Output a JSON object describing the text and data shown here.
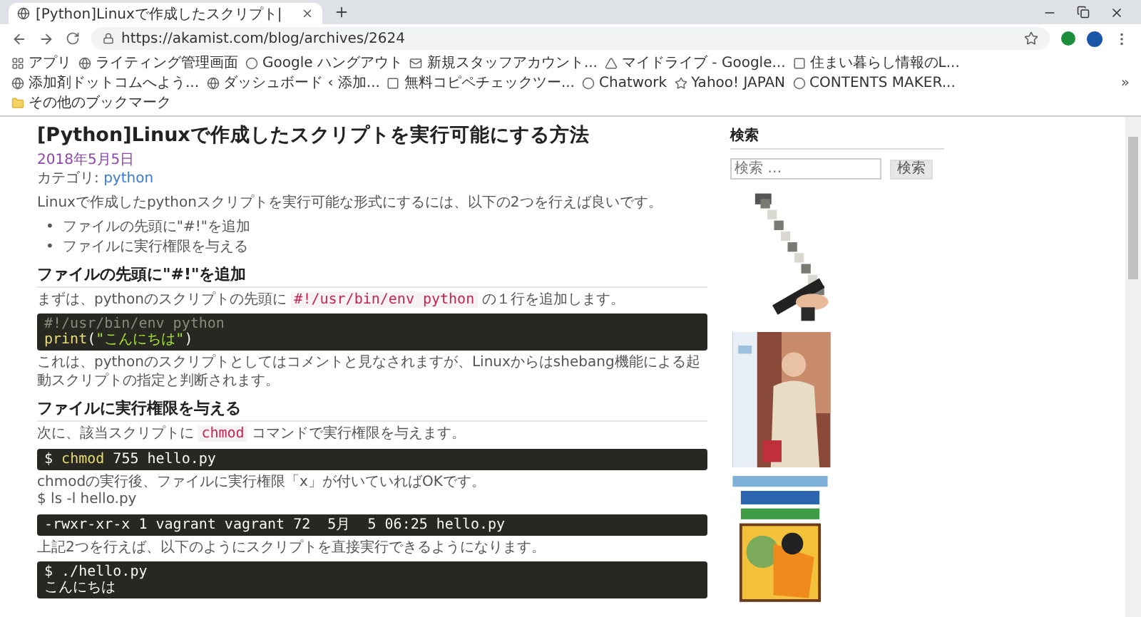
{
  "browser": {
    "tab": {
      "title": "[Python]Linuxで作成したスクリプト|"
    },
    "url": "https://akamist.com/blog/archives/2624",
    "bookmarks": [
      {
        "label": "アプリ"
      },
      {
        "label": "ライティング管理画面"
      },
      {
        "label": "Google ハングアウト"
      },
      {
        "label": "新規スタッフアカウント..."
      },
      {
        "label": "マイドライブ - Google..."
      },
      {
        "label": "住まい暮らし情報のL..."
      },
      {
        "label": "添加剤ドットコムへよう..."
      },
      {
        "label": "ダッシュボード ‹ 添加..."
      },
      {
        "label": "無料コピペチェックツー..."
      },
      {
        "label": "Chatwork"
      },
      {
        "label": "Yahoo! JAPAN"
      },
      {
        "label": "CONTENTS MAKER..."
      }
    ],
    "overflow": "»",
    "other_bookmarks": "その他のブックマーク"
  },
  "article": {
    "title": "[Python]Linuxで作成したスクリプトを実行可能にする方法",
    "date": "2018年5月5日",
    "category_label": "カテゴリ:",
    "category": "python",
    "blocks": [
      {
        "kind": "paragraph",
        "lines": [
          [
            {
              "text": "Linuxで作成したpythonスクリプトを実行可能な形式にするには、以下の2つを行えば良いです。"
            }
          ]
        ]
      },
      {
        "kind": "list",
        "marker": "•",
        "items": [
          "ファイルの先頭に\"#!\"を追加",
          "ファイルに実行権限を与える"
        ]
      },
      {
        "kind": "heading",
        "text": "ファイルの先頭に\"#!\"を追加"
      },
      {
        "kind": "paragraph",
        "lines": [
          [
            {
              "text": "まずは、pythonのスクリプトの先頭に "
            },
            {
              "code": "#!/usr/bin/env python"
            },
            {
              "text": " の１行を追加します。"
            }
          ]
        ]
      },
      {
        "kind": "code",
        "lines": [
          [
            {
              "kind": "comment",
              "text": "#!/usr/bin/env python"
            }
          ],
          [
            {
              "kind": "keyword",
              "text": "print"
            },
            {
              "kind": "plain",
              "text": "("
            },
            {
              "kind": "string",
              "text": "\"こんにちは\""
            },
            {
              "kind": "plain",
              "text": ")"
            }
          ]
        ]
      },
      {
        "kind": "paragraph",
        "lines": [
          [
            {
              "text": "これは、pythonのスクリプトとしてはコメントと見なされますが、Linuxからはshebang機能による起動スクリプトの指定と判断されます。"
            }
          ]
        ]
      },
      {
        "kind": "heading",
        "text": "ファイルに実行権限を与える"
      },
      {
        "kind": "paragraph",
        "lines": [
          [
            {
              "text": "次に、該当スクリプトに "
            },
            {
              "code": "chmod"
            },
            {
              "text": " コマンドで実行権限を与えます。"
            }
          ]
        ]
      },
      {
        "kind": "code",
        "lines": [
          [
            {
              "kind": "plain",
              "text": "$ "
            },
            {
              "kind": "keyword",
              "text": "chmod"
            },
            {
              "kind": "plain",
              "text": " 755 hello.py"
            }
          ]
        ]
      },
      {
        "kind": "paragraph",
        "lines": [
          [
            {
              "text": "chmodの実行後、ファイルに実行権限「x」が付いていればOKです。"
            }
          ],
          [
            {
              "text": "$ ls -l hello.py"
            }
          ]
        ]
      },
      {
        "kind": "code",
        "lines": [
          [
            {
              "kind": "plain",
              "text": "-rwxr-xr-x 1 vagrant vagrant 72  5月  5 06:25 hello.py"
            }
          ]
        ]
      },
      {
        "kind": "paragraph",
        "lines": [
          [
            {
              "text": "上記2つを行えば、以下のようにスクリプトを直接実行できるようになります。"
            }
          ]
        ]
      },
      {
        "kind": "code",
        "lines": [
          [
            {
              "kind": "plain",
              "text": "$ ./hello.py"
            }
          ],
          [
            {
              "kind": "plain",
              "text": "こんにちは"
            }
          ]
        ]
      }
    ]
  },
  "sidebar": {
    "search_heading": "検索",
    "search": {
      "placeholder": "検索 …"
    },
    "search_button": "検索"
  }
}
